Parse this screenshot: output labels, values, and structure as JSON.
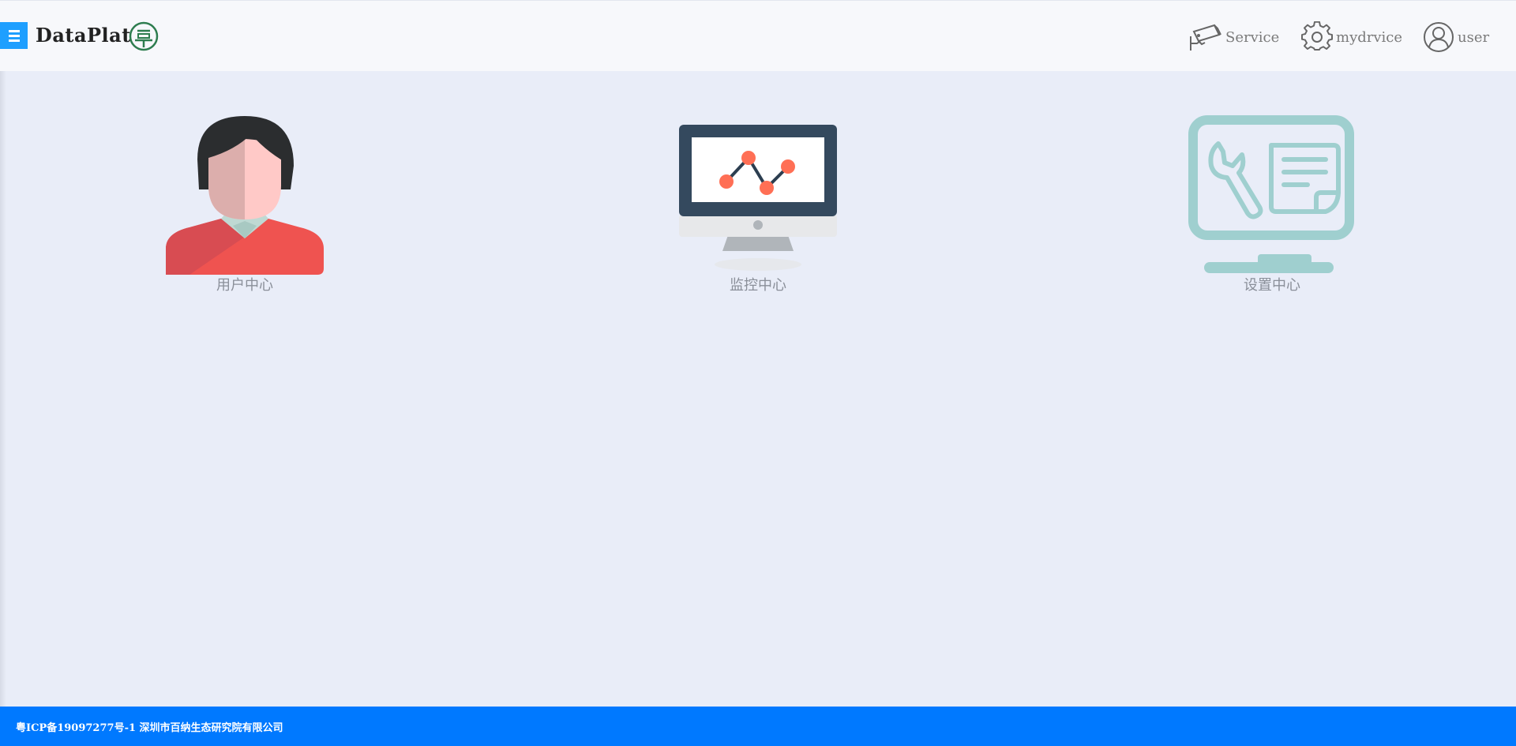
{
  "header": {
    "brand": "DataPlat",
    "nav": [
      {
        "label": "Service",
        "icon": "camera-icon"
      },
      {
        "label": "mydrvice",
        "icon": "gear-icon"
      },
      {
        "label": "user",
        "icon": "user-avatar-icon"
      }
    ]
  },
  "tiles": [
    {
      "label": "用户中心",
      "icon": "user-person-icon"
    },
    {
      "label": "监控中心",
      "icon": "monitor-chart-icon"
    },
    {
      "label": "设置中心",
      "icon": "settings-monitor-icon"
    }
  ],
  "footer": {
    "text": "粤ICP备19097277号-1  深圳市百纳生态研究院有限公司"
  },
  "colors": {
    "accent": "#1e9fff",
    "footer": "#0079ff",
    "background": "#e9edf8",
    "header": "#f7f8fb"
  }
}
